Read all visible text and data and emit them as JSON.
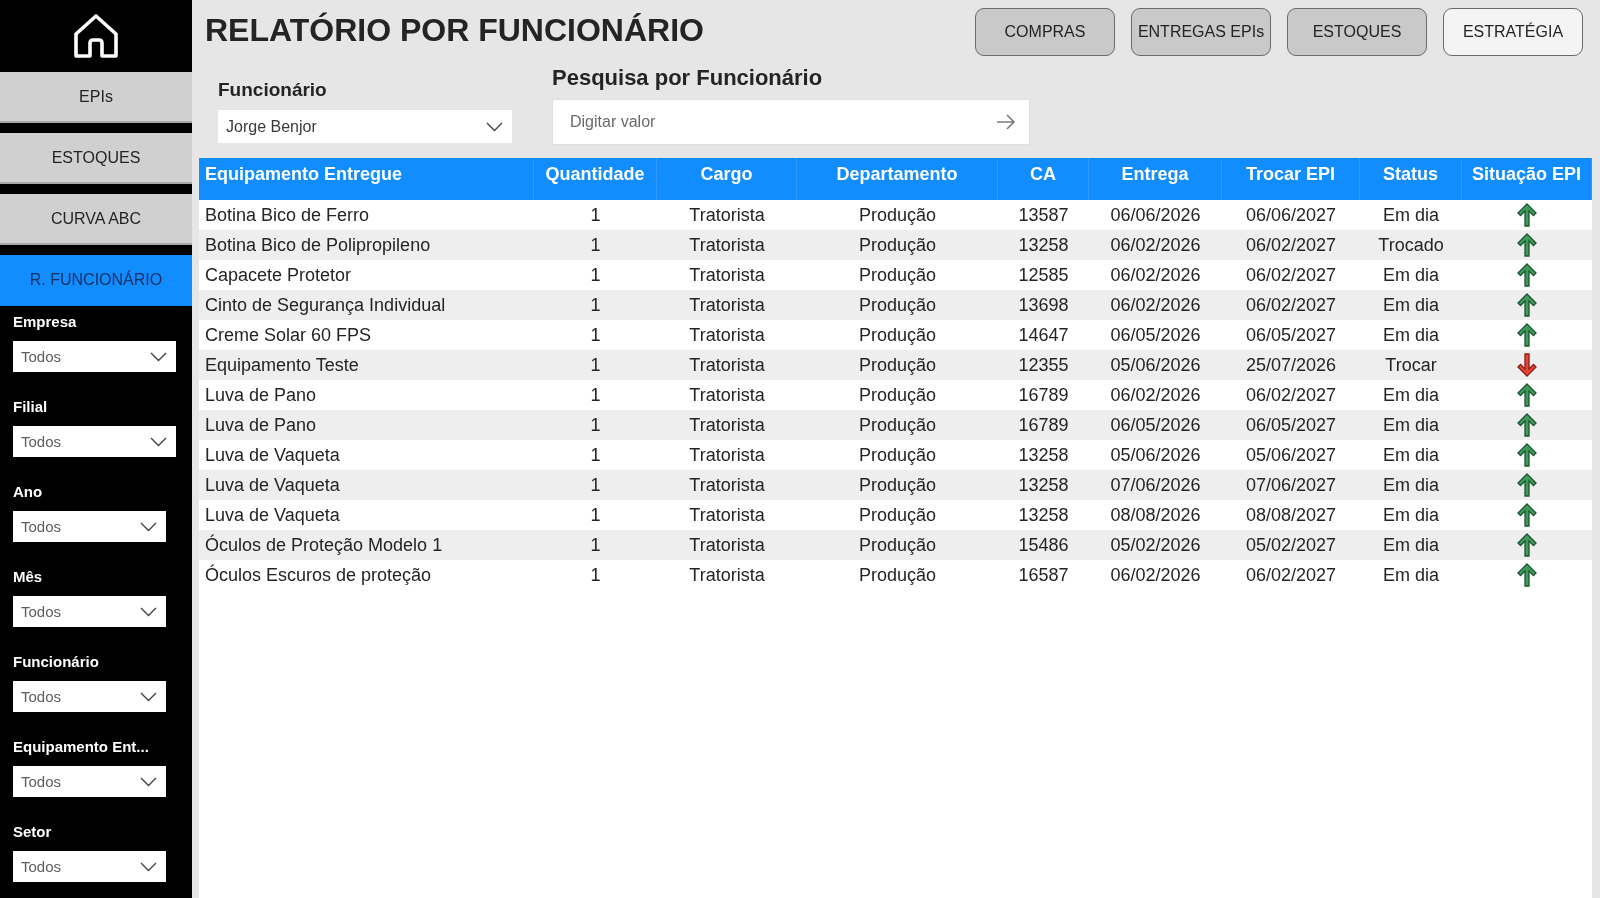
{
  "sidebar": {
    "nav": [
      {
        "label": "EPIs",
        "selected": false
      },
      {
        "label": "ESTOQUES",
        "selected": false
      },
      {
        "label": "CURVA ABC",
        "selected": false
      },
      {
        "label": "R. FUNCIONÁRIO",
        "selected": true
      }
    ],
    "filters": [
      {
        "label": "Empresa",
        "value": "Todos"
      },
      {
        "label": "Filial",
        "value": "Todos"
      },
      {
        "label": "Ano",
        "value": "Todos"
      },
      {
        "label": "Mês",
        "value": "Todos"
      },
      {
        "label": "Funcionário",
        "value": "Todos"
      },
      {
        "label": "Equipamento Ent...",
        "value": "Todos"
      },
      {
        "label": "Setor",
        "value": "Todos"
      }
    ]
  },
  "header": {
    "title": "RELATÓRIO POR FUNCIONÁRIO",
    "buttons": [
      {
        "label": "COMPRAS",
        "highlighted": false
      },
      {
        "label": "ENTREGAS EPIs",
        "highlighted": false
      },
      {
        "label": "ESTOQUES",
        "highlighted": false
      },
      {
        "label": "ESTRATÉGIA",
        "highlighted": true
      }
    ]
  },
  "employee_filter": {
    "label": "Funcionário",
    "value": "Jorge Benjor"
  },
  "search": {
    "label": "Pesquisa por Funcionário",
    "placeholder": "Digitar valor"
  },
  "table": {
    "columns": [
      "Equipamento Entregue",
      "Quantidade",
      "Cargo",
      "Departamento",
      "CA",
      "Entrega",
      "Trocar EPI",
      "Status",
      "Situação EPI"
    ],
    "rows": [
      {
        "cells": [
          "Botina Bico de Ferro",
          "1",
          "Tratorista",
          "Produção",
          "13587",
          "06/06/2026",
          "06/06/2027",
          "Em dia"
        ],
        "replace_due": false
      },
      {
        "cells": [
          "Botina Bico de Polipropileno",
          "1",
          "Tratorista",
          "Produção",
          "13258",
          "06/02/2026",
          "06/02/2027",
          "Trocado"
        ],
        "replace_due": false
      },
      {
        "cells": [
          "Capacete Protetor",
          "1",
          "Tratorista",
          "Produção",
          "12585",
          "06/02/2026",
          "06/02/2027",
          "Em dia"
        ],
        "replace_due": false
      },
      {
        "cells": [
          "Cinto de Segurança Individual",
          "1",
          "Tratorista",
          "Produção",
          "13698",
          "06/02/2026",
          "06/02/2027",
          "Em dia"
        ],
        "replace_due": false
      },
      {
        "cells": [
          "Creme Solar 60 FPS",
          "1",
          "Tratorista",
          "Produção",
          "14647",
          "06/05/2026",
          "06/05/2027",
          "Em dia"
        ],
        "replace_due": false
      },
      {
        "cells": [
          "Equipamento Teste",
          "1",
          "Tratorista",
          "Produção",
          "12355",
          "05/06/2026",
          "25/07/2026",
          "Trocar"
        ],
        "replace_due": true
      },
      {
        "cells": [
          "Luva de Pano",
          "1",
          "Tratorista",
          "Produção",
          "16789",
          "06/02/2026",
          "06/02/2027",
          "Em dia"
        ],
        "replace_due": false
      },
      {
        "cells": [
          "Luva de Pano",
          "1",
          "Tratorista",
          "Produção",
          "16789",
          "06/05/2026",
          "06/05/2027",
          "Em dia"
        ],
        "replace_due": false
      },
      {
        "cells": [
          "Luva de Vaqueta",
          "1",
          "Tratorista",
          "Produção",
          "13258",
          "05/06/2026",
          "05/06/2027",
          "Em dia"
        ],
        "replace_due": false
      },
      {
        "cells": [
          "Luva de Vaqueta",
          "1",
          "Tratorista",
          "Produção",
          "13258",
          "07/06/2026",
          "07/06/2027",
          "Em dia"
        ],
        "replace_due": false
      },
      {
        "cells": [
          "Luva de Vaqueta",
          "1",
          "Tratorista",
          "Produção",
          "13258",
          "08/08/2026",
          "08/08/2027",
          "Em dia"
        ],
        "replace_due": false
      },
      {
        "cells": [
          "Óculos de Proteção Modelo 1",
          "1",
          "Tratorista",
          "Produção",
          "15486",
          "05/02/2026",
          "05/02/2027",
          "Em dia"
        ],
        "replace_due": false
      },
      {
        "cells": [
          "Óculos Escuros de proteção",
          "1",
          "Tratorista",
          "Produção",
          "16587",
          "06/02/2026",
          "06/02/2027",
          "Em dia"
        ],
        "replace_due": false
      }
    ]
  }
}
